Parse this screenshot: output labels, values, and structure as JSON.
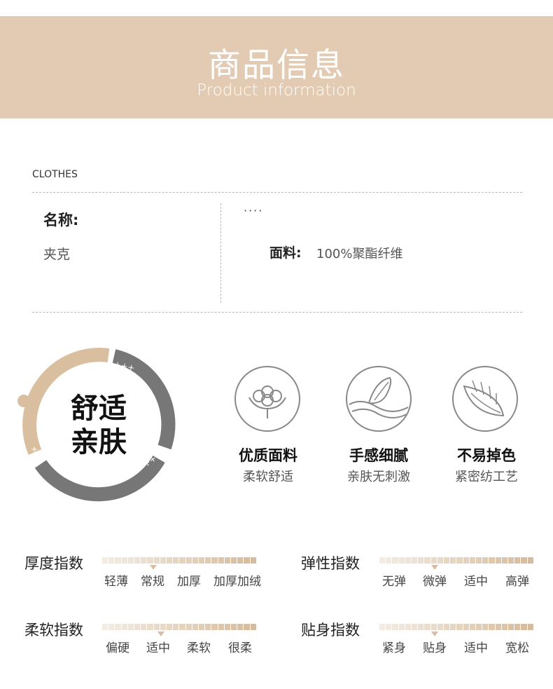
{
  "header": {
    "title": "商品信息",
    "subtitle": "Product information"
  },
  "info": {
    "section_label": "CLOTHES",
    "name_label": "名称:",
    "name_value": "夹克",
    "dots": "····",
    "fabric_label": "面料:",
    "fabric_value": "100%聚酯纤维"
  },
  "comfort": {
    "line1": "舒适",
    "line2": "亲肤",
    "plus_top": "+++",
    "plus_right": "++",
    "plus_left": "+"
  },
  "features": [
    {
      "title": "优质面料",
      "sub": "柔软舒适",
      "icon": "cotton-icon"
    },
    {
      "title": "手感细腻",
      "sub": "亲肤无刺激",
      "icon": "hand-touch-icon"
    },
    {
      "title": "不易掉色",
      "sub": "紧密纺工艺",
      "icon": "leaf-icon"
    }
  ],
  "indices": [
    {
      "label": "厚度指数",
      "options": [
        "轻薄",
        "常规",
        "加厚",
        "加厚加绒"
      ],
      "level": 0.33
    },
    {
      "label": "弹性指数",
      "options": [
        "无弹",
        "微弹",
        "适中",
        "高弹"
      ],
      "level": 0.36
    },
    {
      "label": "柔软指数",
      "options": [
        "偏硬",
        "适中",
        "柔软",
        "很柔"
      ],
      "level": 0.38
    },
    {
      "label": "贴身指数",
      "options": [
        "紧身",
        "贴身",
        "适中",
        "宽松"
      ],
      "level": 0.36
    }
  ],
  "colors": {
    "banner": "#e3cbb3",
    "ring_tan": "#d9bf9f",
    "ring_gray": "#777777",
    "bar_start": "#f3ece3",
    "bar_end": "#d6bc9e"
  }
}
